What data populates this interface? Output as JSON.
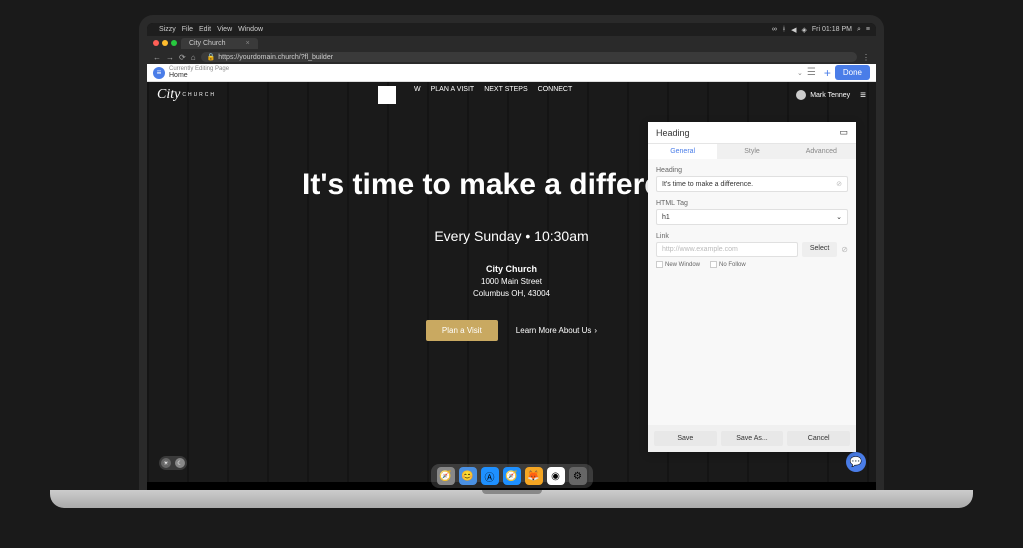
{
  "menubar": {
    "app": "Sizzy",
    "items": [
      "File",
      "Edit",
      "View",
      "Window"
    ],
    "time": "Fri 01:18 PM"
  },
  "browser": {
    "tab": "City Church",
    "url": "https://yourdomain.church/?fl_builder"
  },
  "editbar": {
    "label": "Currently Editing Page",
    "page": "Home",
    "done": "Done"
  },
  "nav": {
    "logo": "City",
    "logo_sub": "CHURCH",
    "items": [
      "W",
      "PLAN A VISIT",
      "NEXT STEPS",
      "CONNECT"
    ],
    "user": "Mark Tenney"
  },
  "hero": {
    "heading": "It's time to make a difference.",
    "subhead": "Every Sunday • 10:30am",
    "church": "City Church",
    "addr1": "1000 Main Street",
    "addr2": "Columbus OH, 43004",
    "primary": "Plan a Visit",
    "secondary": "Learn More About Us"
  },
  "panel": {
    "title": "Heading",
    "tabs": [
      "General",
      "Style",
      "Advanced"
    ],
    "f_heading": "Heading",
    "v_heading": "It's time to make a difference.",
    "f_tag": "HTML Tag",
    "v_tag": "h1",
    "f_link": "Link",
    "p_link": "http://www.example.com",
    "select": "Select",
    "chk1": "New Window",
    "chk2": "No Follow",
    "save": "Save",
    "saveas": "Save As...",
    "cancel": "Cancel"
  }
}
